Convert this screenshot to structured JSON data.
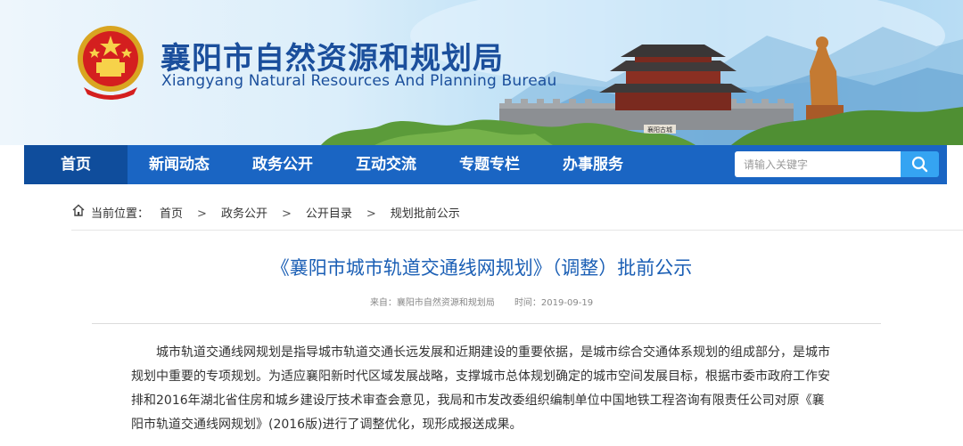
{
  "header": {
    "title": "襄阳市自然资源和规划局",
    "subtitle": "Xiangyang Natural Resources And Planning Bureau",
    "gate_plaque": "襄阳古城"
  },
  "nav": {
    "items": [
      {
        "label": "首页",
        "active": true
      },
      {
        "label": "新闻动态",
        "active": false
      },
      {
        "label": "政务公开",
        "active": false
      },
      {
        "label": "互动交流",
        "active": false
      },
      {
        "label": "专题专栏",
        "active": false
      },
      {
        "label": "办事服务",
        "active": false
      }
    ],
    "search": {
      "placeholder": "请输入关键字",
      "icon": "search-icon"
    }
  },
  "breadcrumb": {
    "icon": "home-icon",
    "prefix": "当前位置：",
    "items": [
      "首页",
      "政务公开",
      "公开目录",
      "规划批前公示"
    ],
    "separator": ">"
  },
  "article": {
    "title": "《襄阳市城市轨道交通线网规划》（调整）批前公示",
    "source": "来自：襄阳市自然资源和规划局",
    "time": "时间：2019-09-19",
    "lines": [
      "城市轨道交通线网规划是指导城市轨道交通长远发展和近期建设的重要依据，是城市综合交通体系规划的组成部分，是城市",
      "规划中重要的专项规划。为适应襄阳新时代区域发展战略，支撑城市总体规划确定的城市空间发展目标，根据市委市政府工作安",
      "排和2016年湖北省住房和城乡建设厅技术审查会意见，我局和市发改委组织编制单位中国地铁工程咨询有限责任公司对原《襄",
      "阳市轨道交通线网规划》(2016版)进行了调整优化，现形成报送成果。"
    ]
  },
  "colors": {
    "nav_bg": "#1a65c3",
    "nav_active": "#0f4d9c",
    "search_button": "#35a4f2",
    "title_blue": "#1b5fb5",
    "brand_blue": "#1b4f9c"
  }
}
